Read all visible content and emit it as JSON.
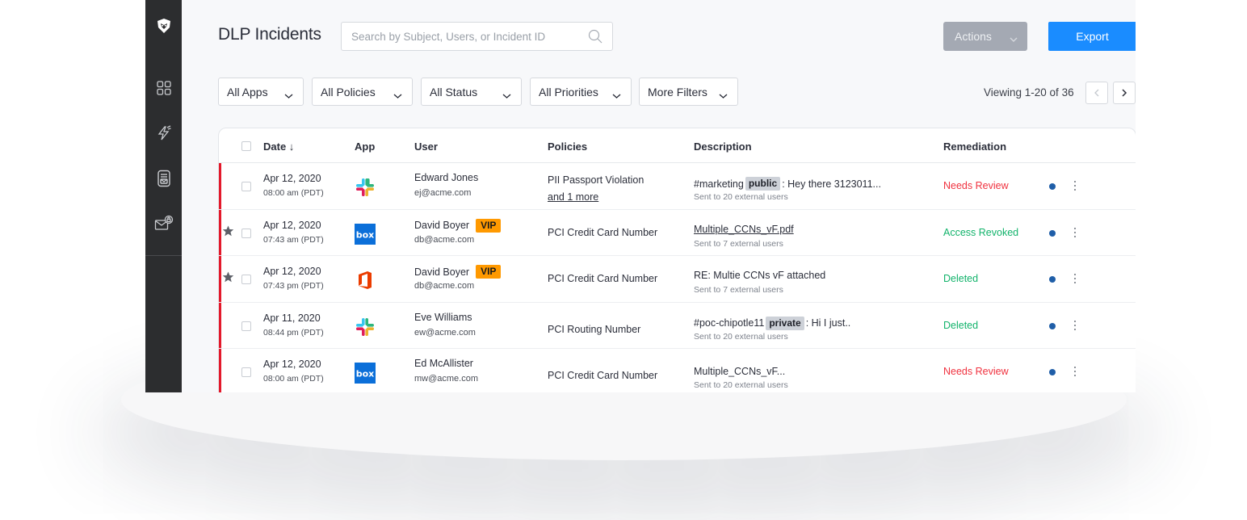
{
  "header": {
    "title": "DLP Incidents",
    "search_placeholder": "Search by Subject, Users, or Incident ID",
    "actions_label": "Actions",
    "export_label": "Export"
  },
  "sidebar": {
    "icons": [
      "shield-logo-icon",
      "grid-icon",
      "lightning-icon",
      "archive-icon",
      "mail-lock-icon"
    ]
  },
  "filters": [
    {
      "label": "All Apps"
    },
    {
      "label": "All Policies"
    },
    {
      "label": "All Status"
    },
    {
      "label": "All Priorities"
    },
    {
      "label": "More Filters"
    }
  ],
  "pagination": {
    "viewing_text": "Viewing 1-20 of 36"
  },
  "table": {
    "columns": {
      "date": "Date ↓",
      "app": "App",
      "user": "User",
      "policies": "Policies",
      "description": "Description",
      "remediation": "Remediation"
    },
    "rows": [
      {
        "date": "Apr 12, 2020",
        "time": "08:00 am (PDT)",
        "app": "slack",
        "starred": false,
        "user_name": "Edward Jones",
        "user_email": "ej@acme.com",
        "vip": "",
        "policy": "PII Passport Violation",
        "policy_more": "and 1 more",
        "desc_pre": "#marketing",
        "desc_tag": "public",
        "desc_post": ": Hey there 3123011...",
        "desc_sub": "Sent to 20 external users",
        "remediation": "Needs Review",
        "remediation_color": "#f0323f"
      },
      {
        "date": "Apr 12, 2020",
        "time": "07:43 am (PDT)",
        "app": "box",
        "starred": true,
        "user_name": "David Boyer",
        "user_email": "db@acme.com",
        "vip": "VIP",
        "policy": "PCI Credit Card Number",
        "policy_more": "",
        "desc_pre": "Multiple_CCNs_vF.pdf",
        "desc_tag": "",
        "desc_post": "",
        "desc_link": true,
        "desc_sub": "Sent to 7 external users",
        "remediation": "Access Revoked",
        "remediation_color": "#12b36b"
      },
      {
        "date": "Apr 12, 2020",
        "time": "07:43 pm (PDT)",
        "app": "office",
        "starred": true,
        "user_name": "David Boyer",
        "user_email": "db@acme.com",
        "vip": "VIP",
        "policy": "PCI Credit Card Number",
        "policy_more": "",
        "desc_pre": "RE: Multie CCNs vF attached",
        "desc_tag": "",
        "desc_post": "",
        "desc_sub": "Sent to 7 external users",
        "remediation": "Deleted",
        "remediation_color": "#12b36b"
      },
      {
        "date": "Apr 11, 2020",
        "time": "08:44 pm (PDT)",
        "app": "slack",
        "starred": false,
        "user_name": "Eve Williams",
        "user_email": "ew@acme.com",
        "vip": "",
        "policy": "PCI Routing Number",
        "policy_more": "",
        "desc_pre": "#poc-chipotle11",
        "desc_tag": "private",
        "desc_post": ": Hi I just..",
        "desc_sub": "Sent to 20 external users",
        "remediation": "Deleted",
        "remediation_color": "#12b36b"
      },
      {
        "date": "Apr 12, 2020",
        "time": "08:00 am (PDT)",
        "app": "box",
        "starred": false,
        "user_name": "Ed McAllister",
        "user_email": "mw@acme.com",
        "vip": "",
        "policy": "PCI Credit Card Number",
        "policy_more": "",
        "desc_pre": "Multiple_CCNs_vF...",
        "desc_tag": "",
        "desc_post": "",
        "desc_sub": "Sent to 20 external users",
        "remediation": "Needs Review",
        "remediation_color": "#f0323f"
      }
    ]
  },
  "colors": {
    "accent": "#1a8cff",
    "sidebar": "#2c2d2f",
    "incident_bar": "#e3192b",
    "vip": "#ff9900"
  }
}
